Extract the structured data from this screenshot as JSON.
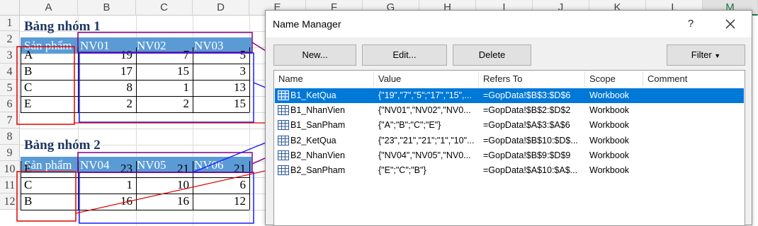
{
  "sheet": {
    "columns": [
      "A",
      "B",
      "C",
      "D",
      "E",
      "F",
      "G",
      "H",
      "I",
      "J",
      "K",
      "L",
      "M"
    ],
    "selected_column": "M",
    "rows": [
      "1",
      "2",
      "3",
      "4",
      "5",
      "6",
      "7",
      "8",
      "9",
      "10",
      "11",
      "12"
    ],
    "group1": {
      "title": "Bảng nhóm 1",
      "header": [
        "Sản phẩm",
        "NV01",
        "NV02",
        "NV03"
      ],
      "data": [
        {
          "product": "A",
          "values": [
            "19",
            "7",
            "5"
          ]
        },
        {
          "product": "B",
          "values": [
            "17",
            "15",
            "3"
          ]
        },
        {
          "product": "C",
          "values": [
            "8",
            "1",
            "13"
          ]
        },
        {
          "product": "E",
          "values": [
            "2",
            "2",
            "15"
          ]
        }
      ]
    },
    "group2": {
      "title": "Bảng nhóm 2",
      "header": [
        "Sản phẩm",
        "NV04",
        "NV05",
        "NV06"
      ],
      "data": [
        {
          "product": "E",
          "values": [
            "23",
            "21",
            "21"
          ]
        },
        {
          "product": "C",
          "values": [
            "1",
            "10",
            "6"
          ]
        },
        {
          "product": "B",
          "values": [
            "16",
            "16",
            "12"
          ]
        }
      ]
    }
  },
  "dialog": {
    "title": "Name Manager",
    "help": "?",
    "buttons": {
      "new": "New...",
      "edit": "Edit...",
      "delete": "Delete",
      "filter": "Filter"
    },
    "columns": [
      "Name",
      "Value",
      "Refers To",
      "Scope",
      "Comment"
    ],
    "names": [
      {
        "name": "B1_KetQua",
        "value": "{\"19\",\"7\",\"5\";\"17\",\"15\",...",
        "refers": "=GopData!$B$3:$D$6",
        "scope": "Workbook",
        "comment": ""
      },
      {
        "name": "B1_NhanVien",
        "value": "{\"NV01\",\"NV02\",\"NV0...",
        "refers": "=GopData!$B$2:$D$2",
        "scope": "Workbook",
        "comment": ""
      },
      {
        "name": "B1_SanPham",
        "value": "{\"A\";\"B\";\"C\";\"E\"}",
        "refers": "=GopData!$A$3:$A$6",
        "scope": "Workbook",
        "comment": ""
      },
      {
        "name": "B2_KetQua",
        "value": "{\"23\",\"21\",\"21\";\"1\",\"10\"...",
        "refers": "=GopData!$B$10:$D$...",
        "scope": "Workbook",
        "comment": ""
      },
      {
        "name": "B2_NhanVien",
        "value": "{\"NV04\",\"NV05\",\"NV0...",
        "refers": "=GopData!$B$9:$D$9",
        "scope": "Workbook",
        "comment": ""
      },
      {
        "name": "B2_SanPham",
        "value": "{\"E\";\"C\";\"B\"}",
        "refers": "=GopData!$A$10:$A$...",
        "scope": "Workbook",
        "comment": ""
      }
    ],
    "selected_index": 0
  },
  "colors": {
    "header_band": "#5b9bd5",
    "title_text": "#1f3864",
    "selection": "#0078d7",
    "annot_red": "#e00000",
    "annot_blue": "#1a1aff",
    "annot_purple": "#800080"
  }
}
